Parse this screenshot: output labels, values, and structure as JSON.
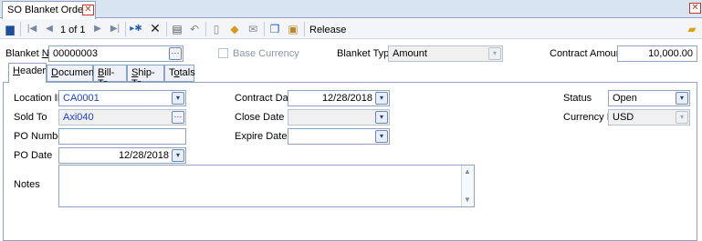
{
  "document_tab": {
    "title": "SO Blanket Orders"
  },
  "toolbar": {
    "record_nav": "1 of 1",
    "release_label": "Release",
    "icons": [
      "save-icon",
      "first-icon",
      "prev-icon",
      "next-icon",
      "last-icon",
      "new-icon",
      "delete-icon",
      "notes-icon",
      "undo-icon",
      "print-icon",
      "attach-icon",
      "email-icon",
      "copy-icon",
      "paste-icon",
      "release-icon"
    ]
  },
  "header_fields": {
    "blanket_no_label_pre": "Blanket ",
    "blanket_no_label_ul": "N",
    "blanket_no_label_post": "o",
    "blanket_no_value": "00000003",
    "base_currency_label": "Base Currency",
    "blanket_type_label": "Blanket Type",
    "blanket_type_value": "Amount",
    "contract_amount_label": "Contract Amount",
    "contract_amount_value": "10,000.00"
  },
  "tabs": [
    {
      "pre": "",
      "ul": "H",
      "post": "eader"
    },
    {
      "pre": "",
      "ul": "D",
      "post": "ocuments"
    },
    {
      "pre": "",
      "ul": "B",
      "post": "ill-To"
    },
    {
      "pre": "",
      "ul": "S",
      "post": "hip-To"
    },
    {
      "pre": "T",
      "ul": "o",
      "post": "tals"
    }
  ],
  "form": {
    "location_id_label": "Location ID",
    "location_id_value": "CA0001",
    "sold_to_label": "Sold To",
    "sold_to_value": "Axi040",
    "po_number_label": "PO Number",
    "po_number_value": "",
    "po_date_label": "PO Date",
    "po_date_value": "12/28/2018",
    "notes_label": "Notes",
    "notes_value": "",
    "contract_date_label": "Contract Date",
    "contract_date_value": "12/28/2018",
    "close_date_label": "Close Date",
    "close_date_value": "",
    "expire_date_label": "Expire Date",
    "expire_date_value": "",
    "status_label": "Status",
    "status_value": "Open",
    "currency_id_label": "Currency ID",
    "currency_id_value": "USD"
  },
  "colors": {
    "link_blue": "#1a3fd0",
    "frame_blue": "#8ea3c0",
    "strip_bg": "#d9e4f2"
  }
}
